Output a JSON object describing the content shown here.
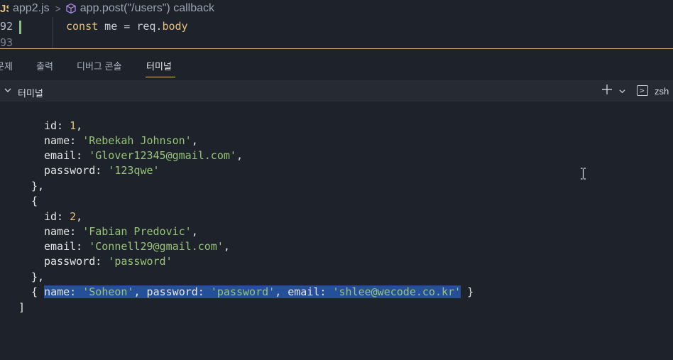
{
  "breadcrumb": {
    "file_icon": "JS",
    "file_name": "app2.js",
    "symbol": "app.post(\"/users\") callback"
  },
  "editor": {
    "lines": [
      {
        "number": "92",
        "code_keyword": "const",
        "code_rest": " me = req.",
        "code_prop": "body"
      },
      {
        "number": "93",
        "code_keyword": "",
        "code_rest": "",
        "code_prop": ""
      }
    ]
  },
  "panel_tabs": [
    "문제",
    "출력",
    "디버그 콘솔",
    "터미널"
  ],
  "active_tab": "터미널",
  "terminal_header": {
    "title": "터미널",
    "shell": "zsh"
  },
  "terminal": {
    "user1": {
      "id": "1",
      "name": "'Rebekah Johnson'",
      "email": "'Glover12345@gmail.com'",
      "password": "'123qwe'"
    },
    "user2": {
      "id": "2",
      "name": "'Fabian Predovic'",
      "email": "'Connell29@gmail.com'",
      "password": "'password'"
    },
    "user3": {
      "name": "'Soheon'",
      "password": "'password'",
      "email": "'shlee@wecode.co.kr'"
    }
  },
  "colors": {
    "background": "#1e222a",
    "string": "#98c379",
    "number": "#e5c07b",
    "selection": "#264f99",
    "accent": "#e5c07b"
  }
}
